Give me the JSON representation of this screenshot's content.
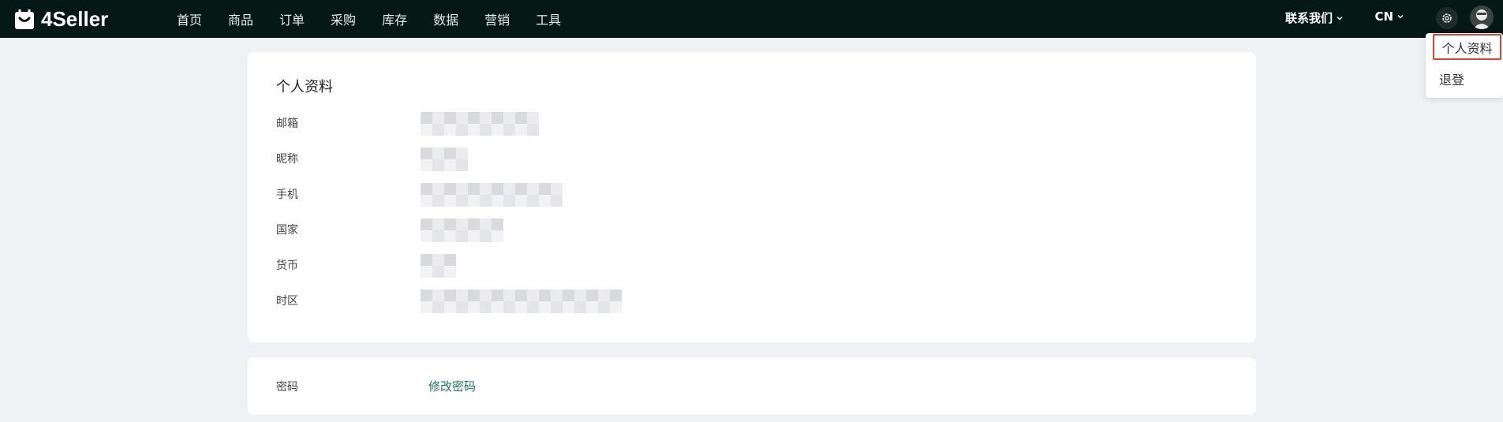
{
  "header": {
    "brand": "4Seller",
    "nav": [
      "首页",
      "商品",
      "订单",
      "采购",
      "库存",
      "数据",
      "营销",
      "工具"
    ],
    "contact_label": "联系我们",
    "lang_label": "CN",
    "settings_icon": "gear-icon",
    "avatar_icon": "user-avatar"
  },
  "dropdown": {
    "profile_label": "个人资料",
    "logout_label": "退登",
    "highlight_color": "#e0403a"
  },
  "profile": {
    "title": "个人资料",
    "fields": [
      {
        "label": "邮箱"
      },
      {
        "label": "昵称"
      },
      {
        "label": "手机"
      },
      {
        "label": "国家"
      },
      {
        "label": "货币"
      },
      {
        "label": "时区"
      }
    ]
  },
  "password": {
    "label": "密码",
    "change_link": "修改密码",
    "link_color": "#1d7a5c"
  }
}
